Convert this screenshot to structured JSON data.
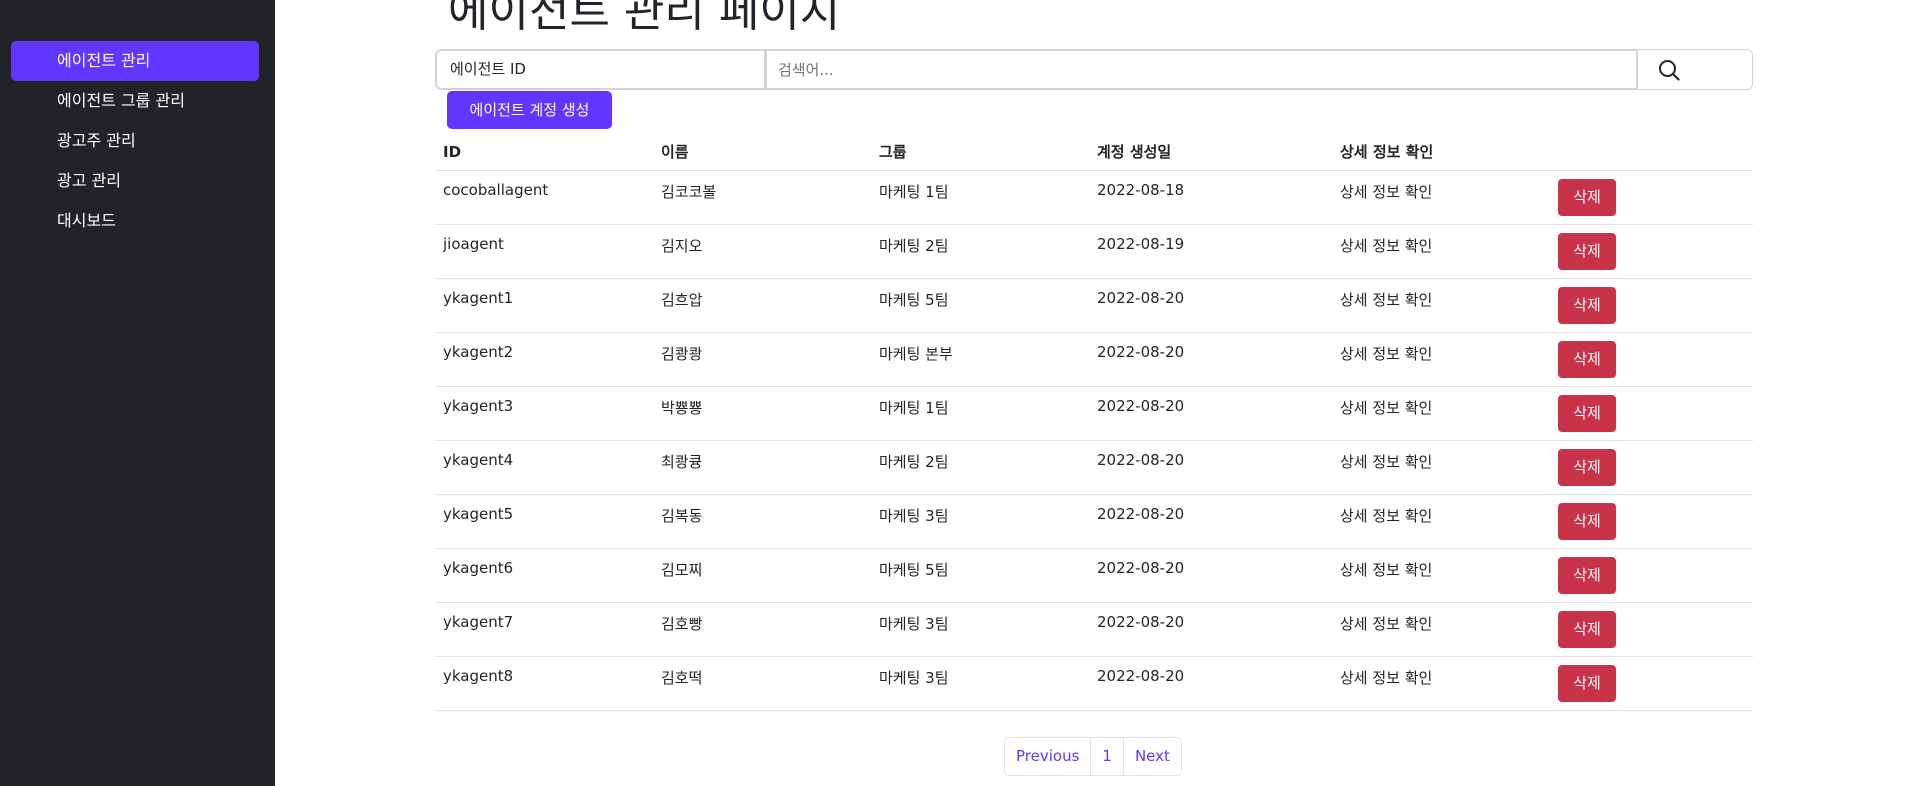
{
  "sidebar": {
    "items": [
      {
        "label": "에이전트 관리",
        "active": true
      },
      {
        "label": "에이전트 그룹 관리",
        "active": false
      },
      {
        "label": "광고주 관리",
        "active": false
      },
      {
        "label": "광고 관리",
        "active": false
      },
      {
        "label": "대시보드",
        "active": false
      }
    ]
  },
  "header": {
    "title": "에이전트 관리 페이지"
  },
  "search": {
    "field_value": "에이전트 ID",
    "placeholder": "검색어...",
    "icon": "search-icon"
  },
  "actions": {
    "create_label": "에이전트 계정 생성"
  },
  "table": {
    "headers": [
      "ID",
      "이름",
      "그룹",
      "계정 생성일",
      "상세 정보 확인",
      ""
    ],
    "delete_label": "삭제",
    "rows": [
      {
        "id": "cocoballagent",
        "name": "김코코볼",
        "group": "마케팅 1팀",
        "created": "2022-08-18",
        "detail": "상세 정보 확인"
      },
      {
        "id": "jioagent",
        "name": "김지오",
        "group": "마케팅 2팀",
        "created": "2022-08-19",
        "detail": "상세 정보 확인"
      },
      {
        "id": "ykagent1",
        "name": "김흐압",
        "group": "마케팅 5팀",
        "created": "2022-08-20",
        "detail": "상세 정보 확인"
      },
      {
        "id": "ykagent2",
        "name": "김쾅쾅",
        "group": "마케팅 본부",
        "created": "2022-08-20",
        "detail": "상세 정보 확인"
      },
      {
        "id": "ykagent3",
        "name": "박뿅뿅",
        "group": "마케팅 1팀",
        "created": "2022-08-20",
        "detail": "상세 정보 확인"
      },
      {
        "id": "ykagent4",
        "name": "최쾅큥",
        "group": "마케팅 2팀",
        "created": "2022-08-20",
        "detail": "상세 정보 확인"
      },
      {
        "id": "ykagent5",
        "name": "김복동",
        "group": "마케팅 3팀",
        "created": "2022-08-20",
        "detail": "상세 정보 확인"
      },
      {
        "id": "ykagent6",
        "name": "김모찌",
        "group": "마케팅 5팀",
        "created": "2022-08-20",
        "detail": "상세 정보 확인"
      },
      {
        "id": "ykagent7",
        "name": "김호빵",
        "group": "마케팅 3팀",
        "created": "2022-08-20",
        "detail": "상세 정보 확인"
      },
      {
        "id": "ykagent8",
        "name": "김호떡",
        "group": "마케팅 3팀",
        "created": "2022-08-20",
        "detail": "상세 정보 확인"
      }
    ]
  },
  "pagination": {
    "prev": "Previous",
    "current": "1",
    "next": "Next"
  },
  "colors": {
    "accent": "#6236ff",
    "sidebar_bg": "#212329",
    "danger": "#c8334a"
  }
}
